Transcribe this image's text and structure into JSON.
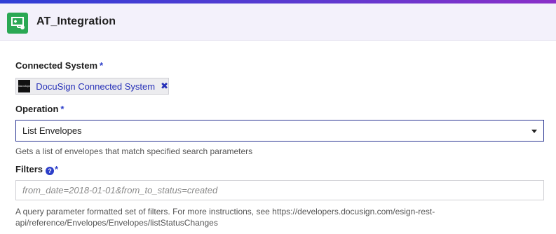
{
  "header": {
    "title": "AT_Integration",
    "icon": "integration-icon",
    "accent_gradient": [
      "#2f3fd6",
      "#8a2fc8"
    ],
    "icon_color": "#2aa854"
  },
  "connected_system": {
    "label": "Connected System",
    "required_mark": "*",
    "chip": {
      "logo_text": "DocuSign",
      "text": "DocuSign Connected System",
      "remove_glyph": "✖"
    }
  },
  "operation": {
    "label": "Operation",
    "required_mark": "*",
    "selected_value": "List Envelopes",
    "help": "Gets a list of envelopes that match specified search parameters"
  },
  "filters": {
    "label": "Filters",
    "help_glyph": "?",
    "required_mark": "*",
    "placeholder": "from_date=2018-01-01&from_to_status=created",
    "value": "",
    "help_line1": "A query parameter formatted set of filters. For more instructions, see https://developers.docusign.com/esign-rest-",
    "help_line2": "api/reference/Envelopes/Envelopes/listStatusChanges"
  },
  "colors": {
    "link_blue": "#2630b8",
    "required_blue": "#2c3ec9",
    "header_bg": "#f3f1fb"
  }
}
